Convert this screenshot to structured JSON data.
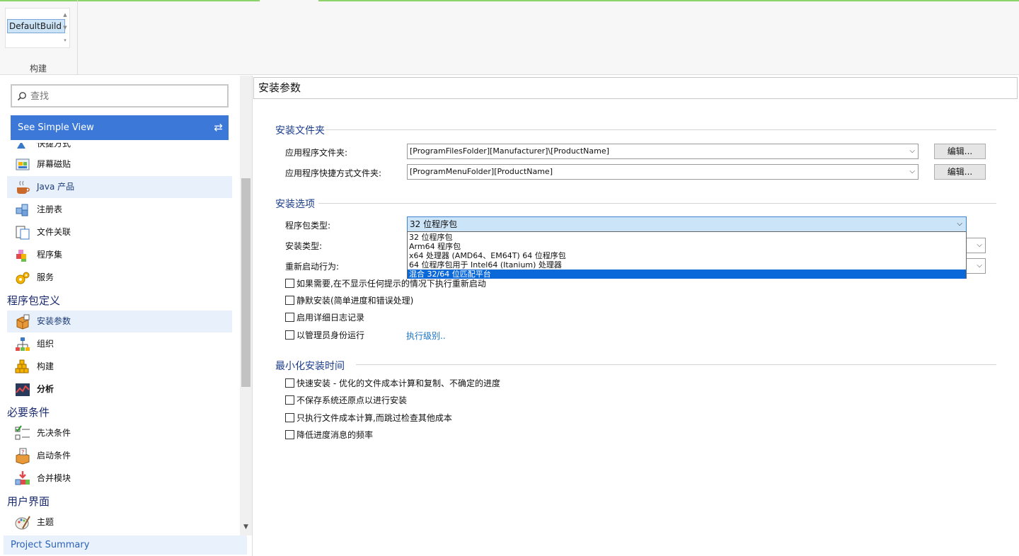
{
  "ribbon": {
    "gallery_item": "DefaultBuild",
    "group_label": "构建"
  },
  "left": {
    "search_placeholder": "查找",
    "simple_view": "See Simple View",
    "nav_items": [
      {
        "label": "快捷方式",
        "icon": "shortcut-icon"
      },
      {
        "label": "屏幕磁贴",
        "icon": "screen-tile-icon"
      },
      {
        "label": "Java 产品",
        "icon": "java-icon"
      },
      {
        "label": "注册表",
        "icon": "registry-icon"
      },
      {
        "label": "文件关联",
        "icon": "file-association-icon"
      },
      {
        "label": "程序集",
        "icon": "assembly-icon"
      },
      {
        "label": "服务",
        "icon": "service-icon"
      },
      {
        "label": "安装参数",
        "icon": "install-params-icon"
      },
      {
        "label": "组织",
        "icon": "organization-icon"
      },
      {
        "label": "构建",
        "icon": "build-icon"
      },
      {
        "label": "分析",
        "icon": "analysis-icon"
      },
      {
        "label": "先决条件",
        "icon": "prerequisites-icon"
      },
      {
        "label": "启动条件",
        "icon": "launch-conditions-icon"
      },
      {
        "label": "合并模块",
        "icon": "merge-modules-icon"
      },
      {
        "label": "主题",
        "icon": "theme-icon"
      }
    ],
    "headings": {
      "package_definition": "程序包定义",
      "requirements": "必要条件",
      "user_interface": "用户界面"
    },
    "project_summary": "Project Summary"
  },
  "main": {
    "title": "安装参数",
    "section_folders": "安装文件夹",
    "app_folder_label": "应用程序文件夹:",
    "app_folder_value": "[ProgramFilesFolder][Manufacturer]\\[ProductName]",
    "shortcut_folder_label": "应用程序快捷方式文件夹:",
    "shortcut_folder_value": "[ProgramMenuFolder][ProductName]",
    "edit_button": "编辑...",
    "section_options": "安装选项",
    "package_type_label": "程序包类型:",
    "package_type_value": "32 位程序包",
    "install_type_label": "安装类型:",
    "restart_label": "重新启动行为:",
    "package_type_options": [
      "32 位程序包",
      "Arm64 程序包",
      "x64 处理器 (AMD64、EM64T) 64 位程序包",
      "64 位程序包用于 Intel64 (Itanium) 处理器",
      "混合 32/64 位匹配平台"
    ],
    "checkboxes_options": [
      "如果需要,在不显示任何提示的情况下执行重新启动",
      "静默安装(简单进度和错误处理)",
      "启用详细日志记录",
      "以管理员身份运行"
    ],
    "exec_level_link": "执行级别..",
    "section_minimize": "最小化安装时间",
    "checkboxes_minimize": [
      "快速安装 - 优化的文件成本计算和复制、不确定的进度",
      "不保存系统还原点以进行安装",
      "只执行文件成本计算,而跳过检查其他成本",
      "降低进度消息的频率"
    ]
  }
}
